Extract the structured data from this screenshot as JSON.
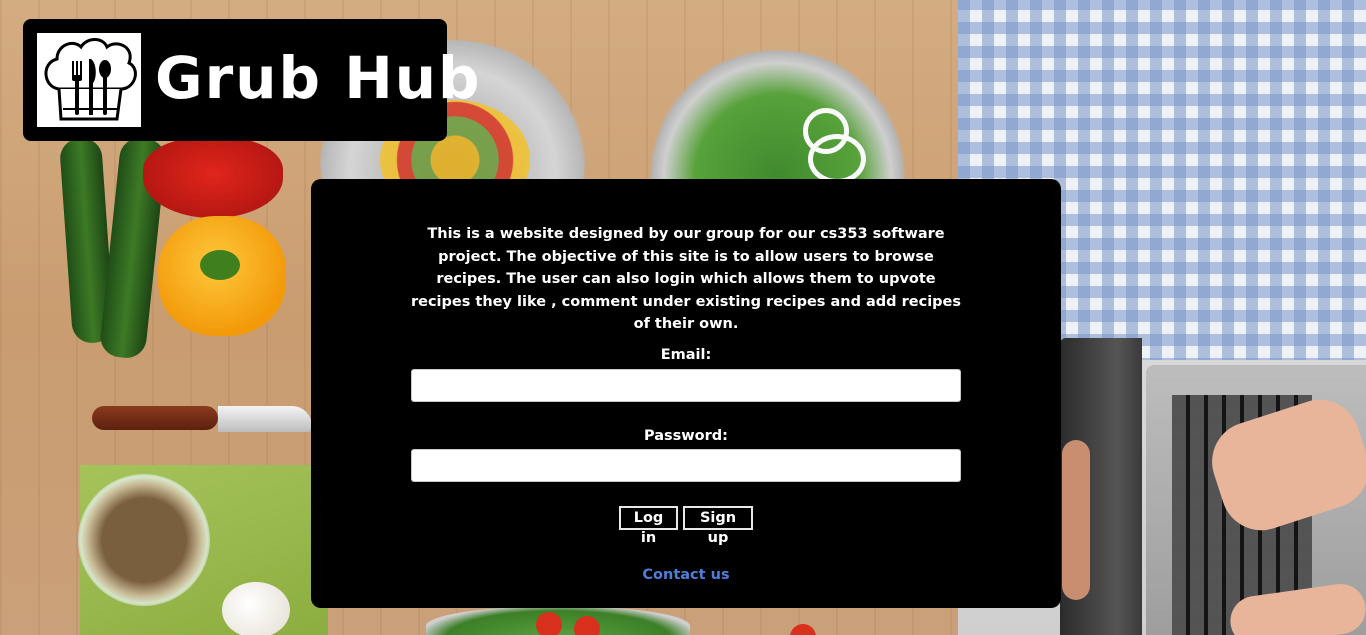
{
  "brand": {
    "title": "Grub Hub",
    "logo_icon": "chef-hat-cutlery-icon",
    "logo_bg": "#000000"
  },
  "intro": {
    "text": "This is a website designed by our group for our cs353 software project. The objective of this site is to allow users to browse recipes. The user can also login which allows them to upvote recipes they like , comment under existing recipes and add recipes of their own."
  },
  "login_form": {
    "email_label": "Email:",
    "email_value": "",
    "password_label": "Password:",
    "password_value": "",
    "login_button": "Log in",
    "signup_button": "Sign up"
  },
  "footer": {
    "contact_link": "Contact us"
  },
  "colors": {
    "panel_bg": "#000000",
    "text": "#ffffff",
    "link": "#4d7ed9"
  }
}
